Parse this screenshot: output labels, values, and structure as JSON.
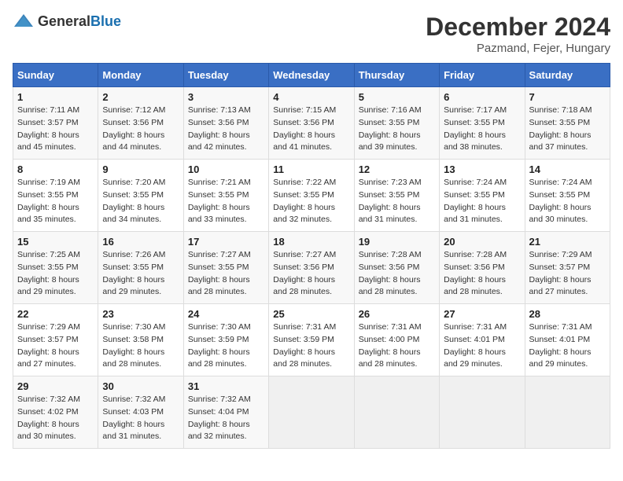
{
  "header": {
    "logo_general": "General",
    "logo_blue": "Blue",
    "month": "December 2024",
    "location": "Pazmand, Fejer, Hungary"
  },
  "days_of_week": [
    "Sunday",
    "Monday",
    "Tuesday",
    "Wednesday",
    "Thursday",
    "Friday",
    "Saturday"
  ],
  "weeks": [
    [
      {
        "day": "1",
        "sunrise": "Sunrise: 7:11 AM",
        "sunset": "Sunset: 3:57 PM",
        "daylight": "Daylight: 8 hours and 45 minutes."
      },
      {
        "day": "2",
        "sunrise": "Sunrise: 7:12 AM",
        "sunset": "Sunset: 3:56 PM",
        "daylight": "Daylight: 8 hours and 44 minutes."
      },
      {
        "day": "3",
        "sunrise": "Sunrise: 7:13 AM",
        "sunset": "Sunset: 3:56 PM",
        "daylight": "Daylight: 8 hours and 42 minutes."
      },
      {
        "day": "4",
        "sunrise": "Sunrise: 7:15 AM",
        "sunset": "Sunset: 3:56 PM",
        "daylight": "Daylight: 8 hours and 41 minutes."
      },
      {
        "day": "5",
        "sunrise": "Sunrise: 7:16 AM",
        "sunset": "Sunset: 3:55 PM",
        "daylight": "Daylight: 8 hours and 39 minutes."
      },
      {
        "day": "6",
        "sunrise": "Sunrise: 7:17 AM",
        "sunset": "Sunset: 3:55 PM",
        "daylight": "Daylight: 8 hours and 38 minutes."
      },
      {
        "day": "7",
        "sunrise": "Sunrise: 7:18 AM",
        "sunset": "Sunset: 3:55 PM",
        "daylight": "Daylight: 8 hours and 37 minutes."
      }
    ],
    [
      {
        "day": "8",
        "sunrise": "Sunrise: 7:19 AM",
        "sunset": "Sunset: 3:55 PM",
        "daylight": "Daylight: 8 hours and 35 minutes."
      },
      {
        "day": "9",
        "sunrise": "Sunrise: 7:20 AM",
        "sunset": "Sunset: 3:55 PM",
        "daylight": "Daylight: 8 hours and 34 minutes."
      },
      {
        "day": "10",
        "sunrise": "Sunrise: 7:21 AM",
        "sunset": "Sunset: 3:55 PM",
        "daylight": "Daylight: 8 hours and 33 minutes."
      },
      {
        "day": "11",
        "sunrise": "Sunrise: 7:22 AM",
        "sunset": "Sunset: 3:55 PM",
        "daylight": "Daylight: 8 hours and 32 minutes."
      },
      {
        "day": "12",
        "sunrise": "Sunrise: 7:23 AM",
        "sunset": "Sunset: 3:55 PM",
        "daylight": "Daylight: 8 hours and 31 minutes."
      },
      {
        "day": "13",
        "sunrise": "Sunrise: 7:24 AM",
        "sunset": "Sunset: 3:55 PM",
        "daylight": "Daylight: 8 hours and 31 minutes."
      },
      {
        "day": "14",
        "sunrise": "Sunrise: 7:24 AM",
        "sunset": "Sunset: 3:55 PM",
        "daylight": "Daylight: 8 hours and 30 minutes."
      }
    ],
    [
      {
        "day": "15",
        "sunrise": "Sunrise: 7:25 AM",
        "sunset": "Sunset: 3:55 PM",
        "daylight": "Daylight: 8 hours and 29 minutes."
      },
      {
        "day": "16",
        "sunrise": "Sunrise: 7:26 AM",
        "sunset": "Sunset: 3:55 PM",
        "daylight": "Daylight: 8 hours and 29 minutes."
      },
      {
        "day": "17",
        "sunrise": "Sunrise: 7:27 AM",
        "sunset": "Sunset: 3:55 PM",
        "daylight": "Daylight: 8 hours and 28 minutes."
      },
      {
        "day": "18",
        "sunrise": "Sunrise: 7:27 AM",
        "sunset": "Sunset: 3:56 PM",
        "daylight": "Daylight: 8 hours and 28 minutes."
      },
      {
        "day": "19",
        "sunrise": "Sunrise: 7:28 AM",
        "sunset": "Sunset: 3:56 PM",
        "daylight": "Daylight: 8 hours and 28 minutes."
      },
      {
        "day": "20",
        "sunrise": "Sunrise: 7:28 AM",
        "sunset": "Sunset: 3:56 PM",
        "daylight": "Daylight: 8 hours and 28 minutes."
      },
      {
        "day": "21",
        "sunrise": "Sunrise: 7:29 AM",
        "sunset": "Sunset: 3:57 PM",
        "daylight": "Daylight: 8 hours and 27 minutes."
      }
    ],
    [
      {
        "day": "22",
        "sunrise": "Sunrise: 7:29 AM",
        "sunset": "Sunset: 3:57 PM",
        "daylight": "Daylight: 8 hours and 27 minutes."
      },
      {
        "day": "23",
        "sunrise": "Sunrise: 7:30 AM",
        "sunset": "Sunset: 3:58 PM",
        "daylight": "Daylight: 8 hours and 28 minutes."
      },
      {
        "day": "24",
        "sunrise": "Sunrise: 7:30 AM",
        "sunset": "Sunset: 3:59 PM",
        "daylight": "Daylight: 8 hours and 28 minutes."
      },
      {
        "day": "25",
        "sunrise": "Sunrise: 7:31 AM",
        "sunset": "Sunset: 3:59 PM",
        "daylight": "Daylight: 8 hours and 28 minutes."
      },
      {
        "day": "26",
        "sunrise": "Sunrise: 7:31 AM",
        "sunset": "Sunset: 4:00 PM",
        "daylight": "Daylight: 8 hours and 28 minutes."
      },
      {
        "day": "27",
        "sunrise": "Sunrise: 7:31 AM",
        "sunset": "Sunset: 4:01 PM",
        "daylight": "Daylight: 8 hours and 29 minutes."
      },
      {
        "day": "28",
        "sunrise": "Sunrise: 7:31 AM",
        "sunset": "Sunset: 4:01 PM",
        "daylight": "Daylight: 8 hours and 29 minutes."
      }
    ],
    [
      {
        "day": "29",
        "sunrise": "Sunrise: 7:32 AM",
        "sunset": "Sunset: 4:02 PM",
        "daylight": "Daylight: 8 hours and 30 minutes."
      },
      {
        "day": "30",
        "sunrise": "Sunrise: 7:32 AM",
        "sunset": "Sunset: 4:03 PM",
        "daylight": "Daylight: 8 hours and 31 minutes."
      },
      {
        "day": "31",
        "sunrise": "Sunrise: 7:32 AM",
        "sunset": "Sunset: 4:04 PM",
        "daylight": "Daylight: 8 hours and 32 minutes."
      },
      null,
      null,
      null,
      null
    ]
  ]
}
